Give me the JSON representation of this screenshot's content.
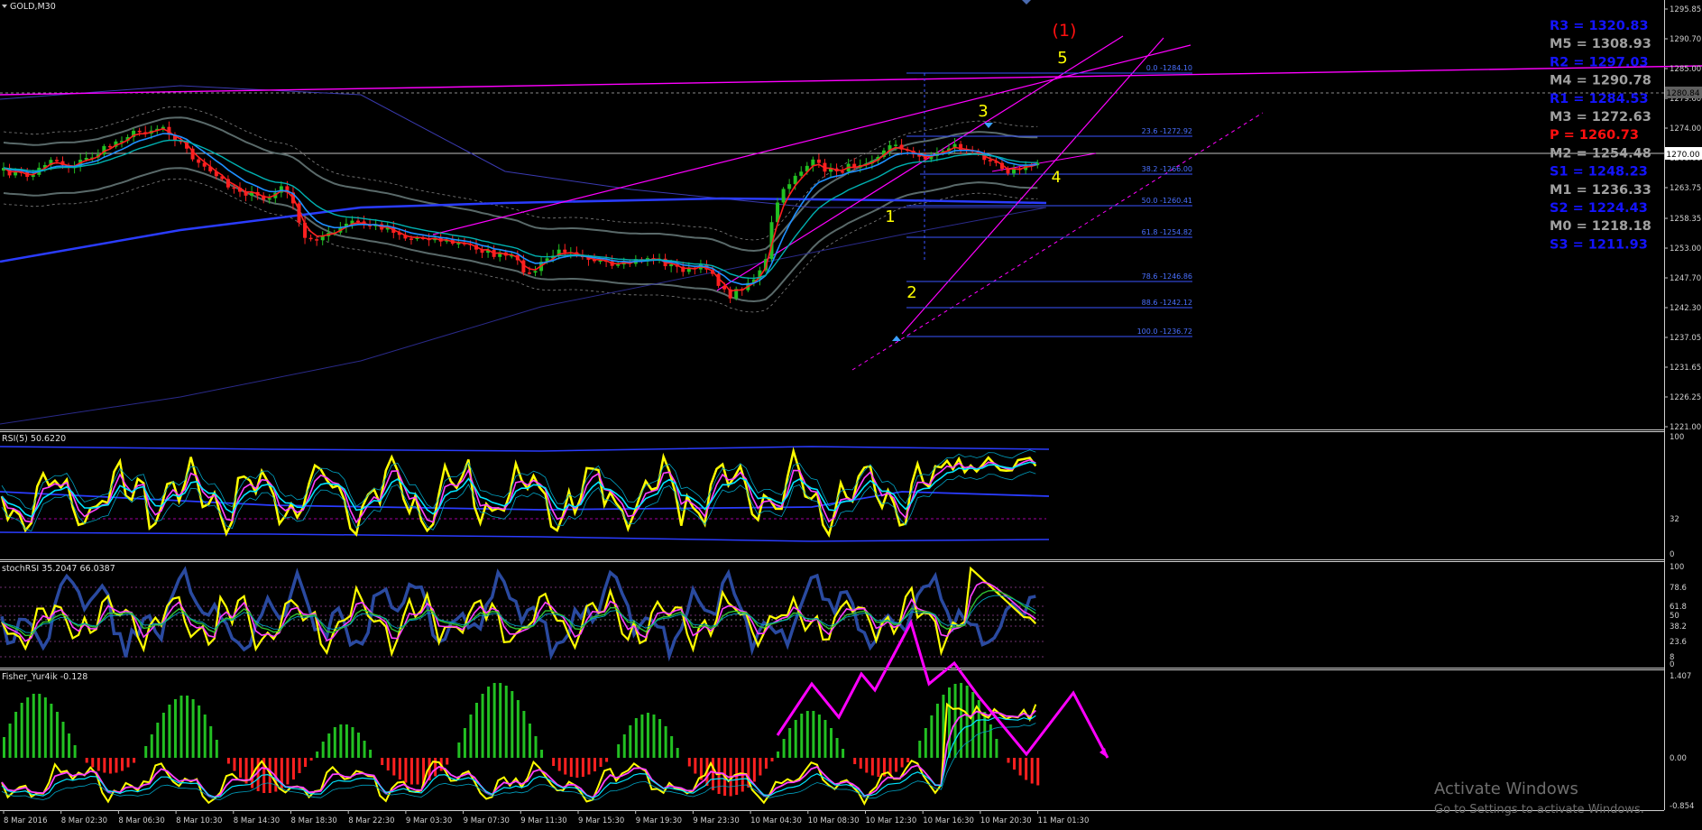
{
  "symbol_title": "GOLD,M30",
  "watermark": {
    "line1": "Activate Windows",
    "line2": "Go to Settings to activate Windows."
  },
  "colors": {
    "background": "#000000",
    "bull": "#22c022",
    "bear": "#ff2020",
    "magenta": "#ff00ff",
    "blue": "#2a3cff",
    "fib": "#3a55ff",
    "yellow": "#ffff00",
    "cyan": "#00e5ff",
    "grid": "#c0c0c0"
  },
  "price_axis": {
    "ticks": [
      "1295.85",
      "1290.70",
      "1285.00",
      "1279.60",
      "1274.00",
      "1268.60",
      "1263.75",
      "1258.35",
      "1253.00",
      "1247.70",
      "1242.30",
      "1237.05",
      "1231.65",
      "1226.25",
      "1221.00"
    ],
    "current_price": "1270.00",
    "top_marker": "1280.84"
  },
  "time_axis": {
    "ticks": [
      "8 Mar 2016",
      "8 Mar 02:30",
      "8 Mar 06:30",
      "8 Mar 10:30",
      "8 Mar 14:30",
      "8 Mar 18:30",
      "8 Mar 22:30",
      "9 Mar 03:30",
      "9 Mar 07:30",
      "9 Mar 11:30",
      "9 Mar 15:30",
      "9 Mar 19:30",
      "9 Mar 23:30",
      "10 Mar 04:30",
      "10 Mar 08:30",
      "10 Mar 12:30",
      "10 Mar 16:30",
      "10 Mar 20:30",
      "11 Mar 01:30"
    ]
  },
  "pivot_levels": [
    {
      "label": "R3 = 1320.83",
      "color": "#1414ff"
    },
    {
      "label": "M5 = 1308.93",
      "color": "#a0a0a0"
    },
    {
      "label": "R2 = 1297.03",
      "color": "#1414ff"
    },
    {
      "label": "M4 = 1290.78",
      "color": "#a0a0a0"
    },
    {
      "label": "R1 = 1284.53",
      "color": "#1414ff"
    },
    {
      "label": "M3 = 1272.63",
      "color": "#a0a0a0"
    },
    {
      "label": "P   = 1260.73",
      "color": "#ff1010"
    },
    {
      "label": "M2 = 1254.48",
      "color": "#a0a0a0"
    },
    {
      "label": "S1 = 1248.23",
      "color": "#1414ff"
    },
    {
      "label": "M1 = 1236.33",
      "color": "#a0a0a0"
    },
    {
      "label": "S2 = 1224.43",
      "color": "#1414ff"
    },
    {
      "label": "M0 = 1218.18",
      "color": "#a0a0a0"
    },
    {
      "label": "S3 = 1211.93",
      "color": "#1414ff"
    }
  ],
  "fib_levels": [
    {
      "label": "0.0 -1284.10"
    },
    {
      "label": "23.6 -1272.92"
    },
    {
      "label": "38.2 -1266.00"
    },
    {
      "label": "50.0 -1260.41"
    },
    {
      "label": "61.8 -1254.82"
    },
    {
      "label": "78.6 -1246.86"
    },
    {
      "label": "88.6 -1242.12"
    },
    {
      "label": "100.0 -1236.72"
    }
  ],
  "wave_labels": [
    {
      "text": "(1)",
      "color": "#ff1010"
    },
    {
      "text": "5",
      "color": "#ffff00"
    },
    {
      "text": "3",
      "color": "#ffff00"
    },
    {
      "text": "4",
      "color": "#ffff00"
    },
    {
      "text": "1",
      "color": "#ffff00"
    },
    {
      "text": "2",
      "color": "#ffff00"
    }
  ],
  "panels": {
    "rsi": {
      "title": "RSI(5) 50.6220",
      "ticks": [
        "100",
        "32",
        "0"
      ]
    },
    "stochrsi": {
      "title": "stochRSI 35.2047 66.0387",
      "ticks": [
        "100",
        "78.6",
        "61.8",
        "50",
        "38.2",
        "23.6",
        "8",
        "0"
      ]
    },
    "fisher": {
      "title": "Fisher_Yur4ik -0.128",
      "ticks": [
        "1.407",
        "0.00",
        "-0.854"
      ]
    }
  }
}
